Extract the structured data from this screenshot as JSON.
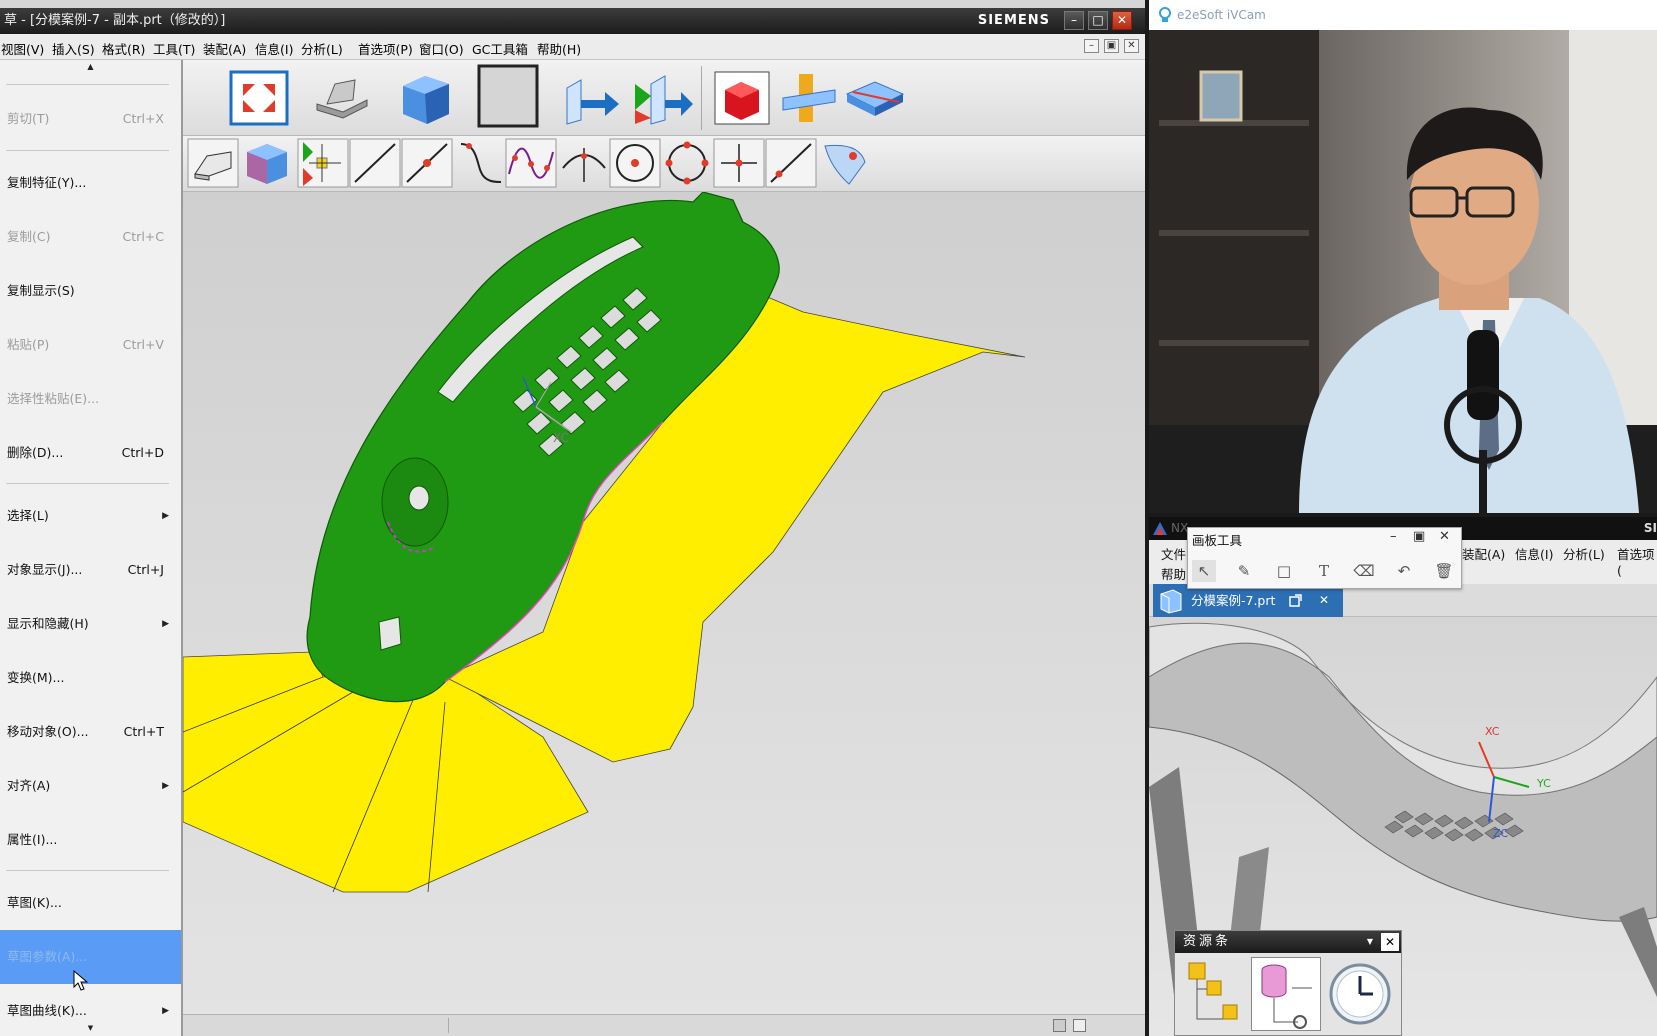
{
  "nx_window": {
    "title": "草 - [分模案例-7 - 副本.prt（修改的）]",
    "brand": "SIEMENS",
    "minimize": "–",
    "maximize": "□",
    "close": "✕"
  },
  "menubar": [
    {
      "label": "视图(V)"
    },
    {
      "label": "插入(S)"
    },
    {
      "label": "格式(R)"
    },
    {
      "label": "工具(T)"
    },
    {
      "label": "装配(A)"
    },
    {
      "label": "信息(I)"
    },
    {
      "label": "分析(L)"
    },
    {
      "label": "首选项(P)"
    },
    {
      "label": "窗口(O)"
    },
    {
      "label": "GC工具箱"
    },
    {
      "label": "帮助(H)"
    }
  ],
  "mdi_controls": [
    "–",
    "▣",
    "✕"
  ],
  "edit_menu": {
    "scroll_up": "▲",
    "scroll_down": "▼",
    "items": [
      {
        "label": "剪切(T)",
        "shortcut": "Ctrl+X",
        "disabled": true
      },
      {
        "label": "复制特征(Y)...",
        "shortcut": "",
        "disabled": false
      },
      {
        "label": "复制(C)",
        "shortcut": "Ctrl+C",
        "disabled": true
      },
      {
        "label": "复制显示(S)",
        "shortcut": "",
        "disabled": false
      },
      {
        "label": "粘贴(P)",
        "shortcut": "Ctrl+V",
        "disabled": true
      },
      {
        "label": "选择性粘贴(E)...",
        "shortcut": "",
        "disabled": true
      },
      {
        "label": "删除(D)...",
        "shortcut": "Ctrl+D",
        "disabled": false
      },
      {
        "label": "选择(L)",
        "shortcut": "",
        "submenu": true
      },
      {
        "label": "对象显示(J)...",
        "shortcut": "Ctrl+J"
      },
      {
        "label": "显示和隐藏(H)",
        "shortcut": "",
        "submenu": true
      },
      {
        "label": "变换(M)...",
        "shortcut": ""
      },
      {
        "label": "移动对象(O)...",
        "shortcut": "Ctrl+T"
      },
      {
        "label": "对齐(A)",
        "shortcut": "",
        "submenu": true
      },
      {
        "label": "属性(I)...",
        "shortcut": ""
      },
      {
        "label": "草图(K)...",
        "shortcut": ""
      },
      {
        "label": "草图参数(A)...",
        "shortcut": "",
        "highlighted": true
      },
      {
        "label": "草图曲线(K)...",
        "shortcut": "",
        "submenu": true
      }
    ]
  },
  "viewport": {
    "axis_label": "XC"
  },
  "camera_window": {
    "title": "e2eSoft iVCam"
  },
  "nx2_window": {
    "title": "NX",
    "brand": "SI",
    "menu_row1": [
      "文件",
      "装配(A)",
      "信息(I)",
      "分析(L)",
      "首选项("
    ],
    "menu_row2": [
      "帮助"
    ],
    "tab_label": "分模案例-7.prt",
    "tab_close": "✕",
    "axis_labels": [
      "XC",
      "YC",
      "ZC"
    ]
  },
  "painter_toolbar": {
    "title": "画板工具",
    "controls": [
      "–",
      "▣",
      "✕"
    ]
  },
  "resource_bar": {
    "title": "资源条",
    "close": "✕"
  },
  "colors": {
    "part_green": "#1f9a12",
    "surface_yellow": "#ffee00",
    "menu_highlight": "#5a9bf5",
    "tab_blue": "#2d6fb3"
  }
}
